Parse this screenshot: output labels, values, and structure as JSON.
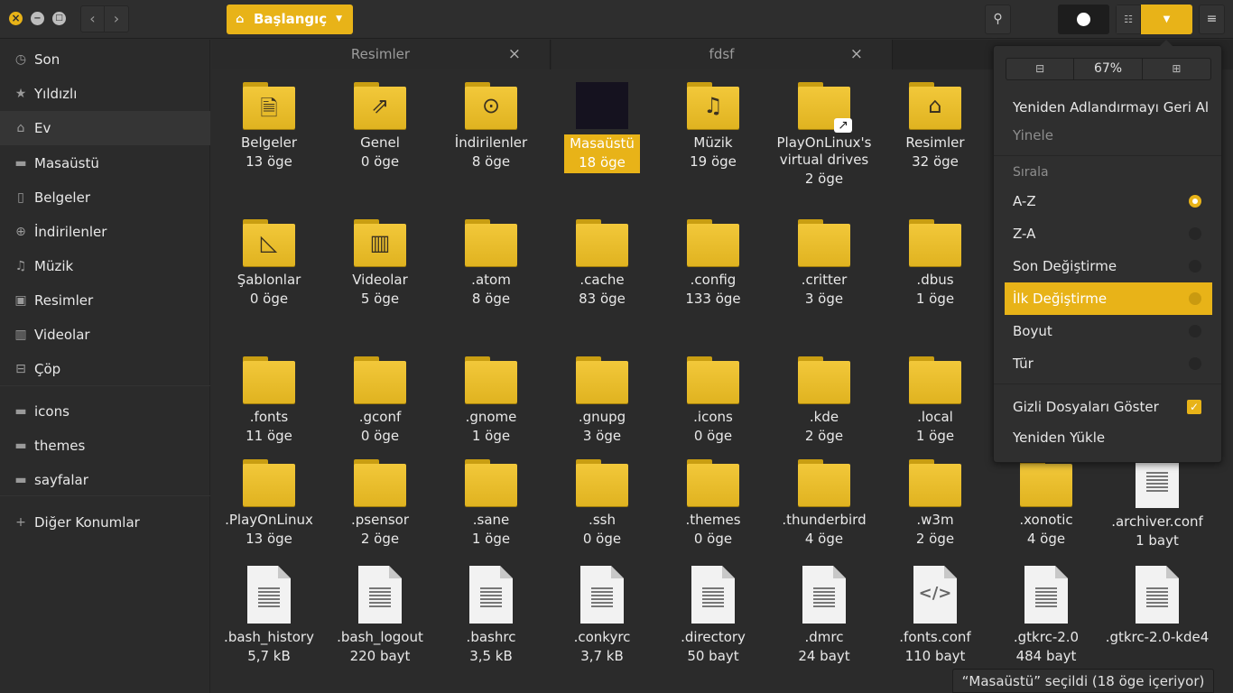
{
  "header": {
    "location_label": "Başlangıç"
  },
  "sidebar": {
    "items": [
      {
        "label": "Son",
        "icon": "clock-icon"
      },
      {
        "label": "Yıldızlı",
        "icon": "star-icon"
      },
      {
        "label": "Ev",
        "icon": "home-icon"
      },
      {
        "label": "Masaüstü",
        "icon": "folder-icon"
      },
      {
        "label": "Belgeler",
        "icon": "document-icon"
      },
      {
        "label": "İndirilenler",
        "icon": "download-icon"
      },
      {
        "label": "Müzik",
        "icon": "music-icon"
      },
      {
        "label": "Resimler",
        "icon": "image-icon"
      },
      {
        "label": "Videolar",
        "icon": "film-icon"
      },
      {
        "label": "Çöp",
        "icon": "trash-icon"
      },
      {
        "label": "icons",
        "icon": "folder-icon"
      },
      {
        "label": "themes",
        "icon": "folder-icon"
      },
      {
        "label": "sayfalar",
        "icon": "folder-icon"
      },
      {
        "label": "Diğer Konumlar",
        "icon": "plus-icon"
      }
    ]
  },
  "tabs": [
    {
      "label": "Resimler"
    },
    {
      "label": "fdsf"
    }
  ],
  "files": [
    {
      "name": "Belgeler",
      "count": "13 öge"
    },
    {
      "name": "Genel",
      "count": "0 öge"
    },
    {
      "name": "İndirilenler",
      "count": "8 öge"
    },
    {
      "name": "Masaüstü",
      "count": "18 öge"
    },
    {
      "name": "Müzik",
      "count": "19 öge"
    },
    {
      "name": "PlayOnLinux's virtual drives",
      "count": "2 öge"
    },
    {
      "name": "Resimler",
      "count": "32 öge"
    },
    {
      "name": "Şablonlar",
      "count": "0 öge"
    },
    {
      "name": "Videolar",
      "count": "5 öge"
    },
    {
      "name": ".atom",
      "count": "8 öge"
    },
    {
      "name": ".cache",
      "count": "83 öge"
    },
    {
      "name": ".config",
      "count": "133 öge"
    },
    {
      "name": ".critter",
      "count": "3 öge"
    },
    {
      "name": ".dbus",
      "count": "1 öge"
    },
    {
      "name": ".fonts",
      "count": "11 öge"
    },
    {
      "name": ".gconf",
      "count": "0 öge"
    },
    {
      "name": ".gnome",
      "count": "1 öge"
    },
    {
      "name": ".gnupg",
      "count": "3 öge"
    },
    {
      "name": ".icons",
      "count": "0 öge"
    },
    {
      "name": ".kde",
      "count": "2 öge"
    },
    {
      "name": ".local",
      "count": "1 öge"
    },
    {
      "name": ".PlayOnLinux",
      "count": "13 öge"
    },
    {
      "name": ".psensor",
      "count": "2 öge"
    },
    {
      "name": ".sane",
      "count": "1 öge"
    },
    {
      "name": ".ssh",
      "count": "0 öge"
    },
    {
      "name": ".themes",
      "count": "0 öge"
    },
    {
      "name": ".thunderbird",
      "count": "4 öge"
    },
    {
      "name": ".w3m",
      "count": "2 öge"
    },
    {
      "name": ".xonotic",
      "count": "4 öge"
    },
    {
      "name": ".archiver.conf",
      "count": "1 bayt"
    },
    {
      "name": ".bash_history",
      "count": "5,7 kB"
    },
    {
      "name": ".bash_logout",
      "count": "220 bayt"
    },
    {
      "name": ".bashrc",
      "count": "3,5 kB"
    },
    {
      "name": ".conkyrc",
      "count": "3,7 kB"
    },
    {
      "name": ".directory",
      "count": "50 bayt"
    },
    {
      "name": ".dmrc",
      "count": "24 bayt"
    },
    {
      "name": ".fonts.conf",
      "count": "110 bayt"
    },
    {
      "name": ".gtkrc-2.0",
      "count": "484 bayt"
    },
    {
      "name": ".gtkrc-2.0-kde4",
      "count": ""
    }
  ],
  "popover": {
    "zoom_level": "67%",
    "undo_rename": "Yeniden Adlandırmayı Geri Al",
    "redo": "Yinele",
    "sort_heading": "Sırala",
    "sort_options": [
      {
        "label": "A-Z",
        "selected": true
      },
      {
        "label": "Z-A",
        "selected": false
      },
      {
        "label": "Son Değiştirme",
        "selected": false
      },
      {
        "label": "İlk Değiştirme",
        "selected": false
      },
      {
        "label": "Boyut",
        "selected": false
      },
      {
        "label": "Tür",
        "selected": false
      }
    ],
    "show_hidden": "Gizli Dosyaları Göster",
    "show_hidden_checked": true,
    "reload": "Yeniden Yükle"
  },
  "status": {
    "text": "“Masaüstü” seçildi (18 öge içeriyor)"
  },
  "colors": {
    "accent": "#e8b318",
    "background": "#2b2b2b"
  }
}
